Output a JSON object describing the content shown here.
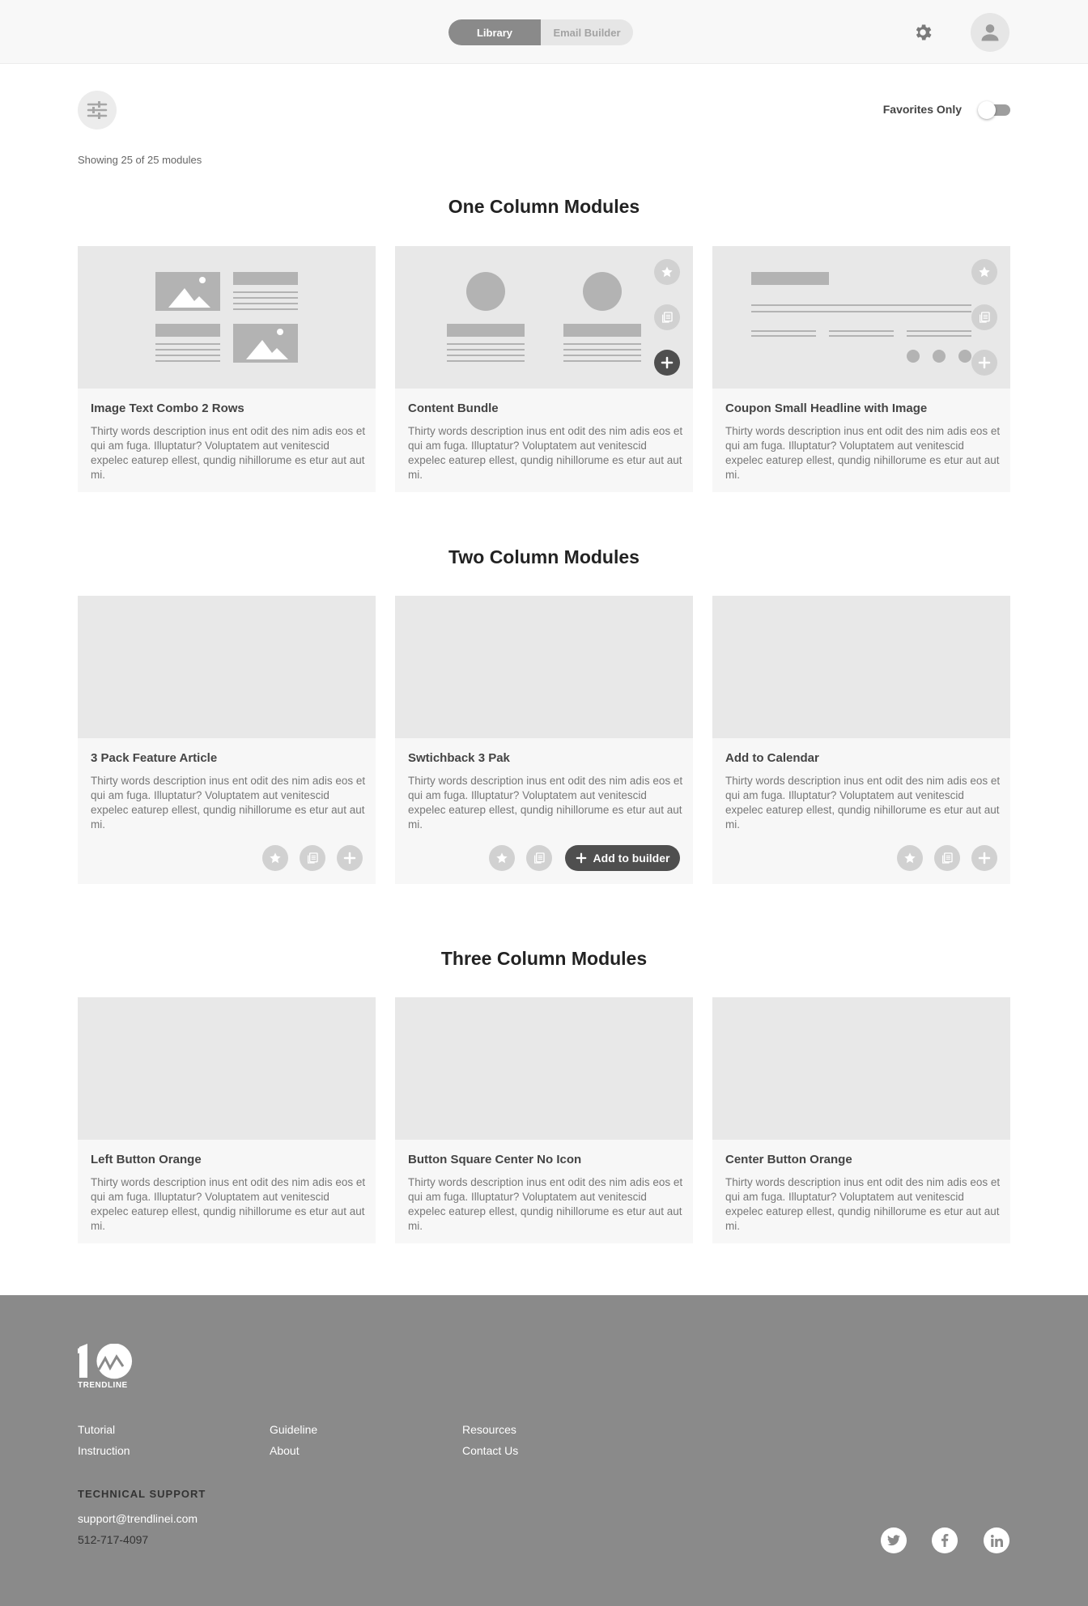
{
  "header": {
    "tabs": [
      {
        "label": "Library",
        "active": true
      },
      {
        "label": "Email Builder",
        "active": false
      }
    ],
    "settings_icon": "gear-icon",
    "profile_icon": "user-icon"
  },
  "toolbar": {
    "filter_icon": "sliders-icon",
    "favorites_label": "Favorites Only",
    "favorites_on": false,
    "showing_text": "Showing 25 of 25 modules"
  },
  "sections": [
    {
      "title": "One Column Modules",
      "cards": [
        {
          "title": "Image Text Combo 2 Rows",
          "desc": "Thirty words description inus ent odit des nim adis eos et qui am fuga. Illuptatur? Voluptatem aut venitescid expelec eaturep ellest, qundig nihillorume es etur aut aut mi."
        },
        {
          "title": "Content Bundle",
          "desc": "Thirty words description inus ent odit des nim adis eos et qui am fuga. Illuptatur? Voluptatem aut venitescid expelec eaturep ellest, qundig nihillorume es etur aut aut mi."
        },
        {
          "title": "Coupon Small Headline with Image",
          "desc": "Thirty words description inus ent odit des nim adis eos et qui am fuga. Illuptatur? Voluptatem aut venitescid expelec eaturep ellest, qundig nihillorume es etur aut aut mi."
        }
      ]
    },
    {
      "title": "Two Column Modules",
      "cards": [
        {
          "title": "3 Pack Feature Article",
          "desc": "Thirty words description inus ent odit des nim adis eos et qui am fuga. Illuptatur? Voluptatem aut venitescid expelec eaturep ellest, qundig nihillorume es etur aut aut mi."
        },
        {
          "title": "Swtichback 3 Pak",
          "desc": "Thirty words description inus ent odit des nim adis eos et qui am fuga. Illuptatur? Voluptatem aut venitescid expelec eaturep ellest, qundig nihillorume es etur aut aut mi."
        },
        {
          "title": "Add to Calendar",
          "desc": "Thirty words description inus ent odit des nim adis eos et qui am fuga. Illuptatur? Voluptatem aut venitescid expelec eaturep ellest, qundig nihillorume es etur aut aut mi."
        }
      ]
    },
    {
      "title": "Three Column Modules",
      "cards": [
        {
          "title": "Left Button Orange",
          "desc": "Thirty words description inus ent odit des nim adis eos et qui am fuga. Illuptatur? Voluptatem aut venitescid expelec eaturep ellest, qundig nihillorume es etur aut aut mi."
        },
        {
          "title": "Button Square Center No Icon",
          "desc": "Thirty words description inus ent odit des nim adis eos et qui am fuga. Illuptatur? Voluptatem aut venitescid expelec eaturep ellest, qundig nihillorume es etur aut aut mi."
        },
        {
          "title": "Center Button Orange",
          "desc": "Thirty words description inus ent odit des nim adis eos et qui am fuga. Illuptatur? Voluptatem aut venitescid expelec eaturep ellest, qundig nihillorume es etur aut aut mi."
        }
      ]
    }
  ],
  "add_to_builder_label": "Add to builder",
  "footer": {
    "logo_text": "TRENDLINE",
    "links": [
      "Tutorial",
      "Instruction",
      "Guideline",
      "About",
      "Resources",
      "Contact Us"
    ],
    "support_title": "TECHNICAL SUPPORT",
    "support_email": "support@trendlinei.com",
    "support_phone": "512-717-4097",
    "social_icons": [
      "twitter-icon",
      "facebook-icon",
      "linkedin-icon"
    ]
  },
  "colors": {
    "footer_bg": "#8a8a8a",
    "card_bg": "#f7f7f7",
    "thumb_bg": "#e8e8e8",
    "dark_button": "#4f4f4f"
  }
}
